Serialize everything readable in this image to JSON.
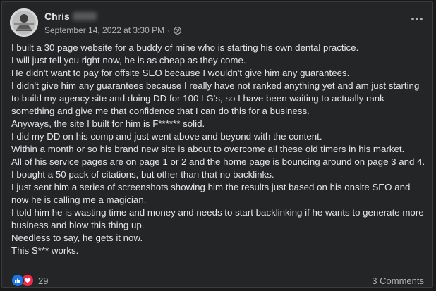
{
  "post": {
    "author_name": "Chris",
    "timestamp": "September 14, 2022 at 3:30 PM",
    "separator": "·",
    "privacy_icon": "globe-icon",
    "paragraphs": [
      "I built a 30 page website for a buddy of mine who is starting his own dental practice.",
      "I will just tell you right now, he is as cheap as they come.",
      "He didn't want to pay for offsite SEO because I wouldn't give him any guarantees.",
      "I didn't give him any guarantees because I really have not ranked anything yet and am just starting to build my agency site and doing DD for 100 LG's, so I have been waiting to actually rank something and give me that confidence that I can do this for a business.",
      "Anyways, the site I built for him is F****** solid.",
      "I did my DD on his comp and just went above and beyond with the content.",
      "Within a month or so his brand new site is about to overcome all these old timers in his market.",
      "All of his service pages are on page 1 or 2 and the home page is bouncing around on page 3 and 4.",
      "I bought a 50 pack of citations, but other than that no backlinks.",
      "I just sent him a series of screenshots showing him the results just based on his onsite SEO and now he is calling me a magician.",
      "I told him he is wasting time and money and needs to start backlinking if he wants to generate more business and blow this thing up.",
      "Needless to say, he gets it now.",
      "This S*** works."
    ]
  },
  "footer": {
    "reaction_icons": [
      "like-icon",
      "love-icon"
    ],
    "reaction_count": "29",
    "comments_label": "3 Comments"
  },
  "colors": {
    "card_bg": "#242526",
    "text_primary": "#e4e6eb",
    "text_secondary": "#b0b3b8",
    "like_blue": "#1b74e4",
    "love_red": "#f02849"
  }
}
